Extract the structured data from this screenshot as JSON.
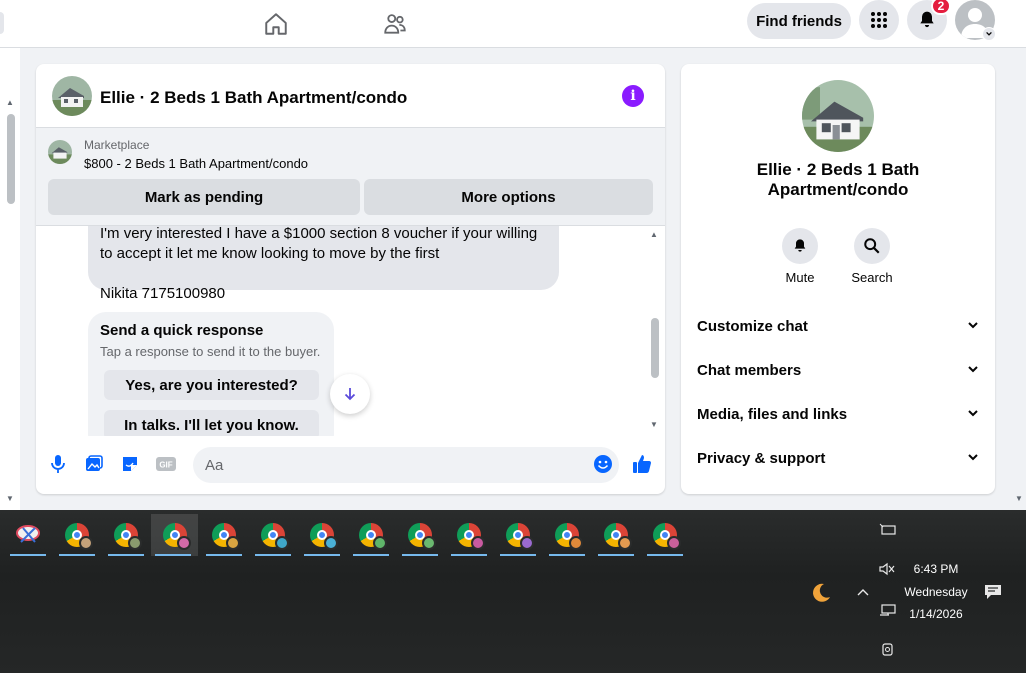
{
  "topbar": {
    "nav": [
      {
        "name": "home-icon"
      },
      {
        "name": "friends-icon"
      }
    ],
    "find_friends_label": "Find friends",
    "notifications_count": "2",
    "icons": [
      "menu-grid-icon",
      "bell-icon",
      "avatar",
      "chevron-down-icon"
    ]
  },
  "chat": {
    "title": "Ellie · 2 Beds 1 Bath Apartment/condo",
    "listing": {
      "source": "Marketplace",
      "text": "$800 - 2 Beds 1 Bath Apartment/condo",
      "mark_pending_label": "Mark as pending",
      "more_options_label": "More options"
    },
    "messages": {
      "line1": "I'm very interested I have a $1000 section 8 voucher if your willing",
      "line2": "to accept it let me know looking to move by the first",
      "line3": "Nikita 7175100980"
    },
    "quick_response": {
      "title": "Send a quick response",
      "subtitle": "Tap a response to send it to the buyer.",
      "options": [
        "Yes, are you interested?",
        "In talks. I'll let you know."
      ]
    },
    "composer": {
      "placeholder": "Aa",
      "icons": [
        "microphone-icon",
        "photo-icon",
        "sticker-icon",
        "gif-icon",
        "emoji-icon",
        "thumbs-up-icon"
      ]
    }
  },
  "info_panel": {
    "name_line1": "Ellie · 2 Beds 1 Bath",
    "name_line2": "Apartment/condo",
    "actions": [
      {
        "label": "Mute",
        "icon": "bell-icon"
      },
      {
        "label": "Search",
        "icon": "search-icon"
      }
    ],
    "sections": [
      "Customize chat",
      "Chat members",
      "Media, files and links",
      "Privacy & support"
    ]
  },
  "taskbar": {
    "time": "6:43 PM",
    "day": "Wednesday",
    "date": "1/14/2026",
    "apps": [
      "snipping-tool-icon",
      "chrome-icon",
      "chrome-icon",
      "chrome-icon",
      "chrome-icon",
      "chrome-icon",
      "chrome-icon",
      "chrome-icon",
      "chrome-icon",
      "chrome-icon",
      "chrome-icon",
      "chrome-icon",
      "chrome-icon",
      "chrome-icon"
    ],
    "tray_icons": [
      "battery-icon",
      "volume-muted-icon",
      "network-icon",
      "chevron-up-icon",
      "moon-icon",
      "notification-icon",
      "camera-icon"
    ]
  },
  "colors": {
    "accent_blue": "#0866ff",
    "info_purple": "#8a1bff",
    "badge_red": "#e41e3f"
  }
}
